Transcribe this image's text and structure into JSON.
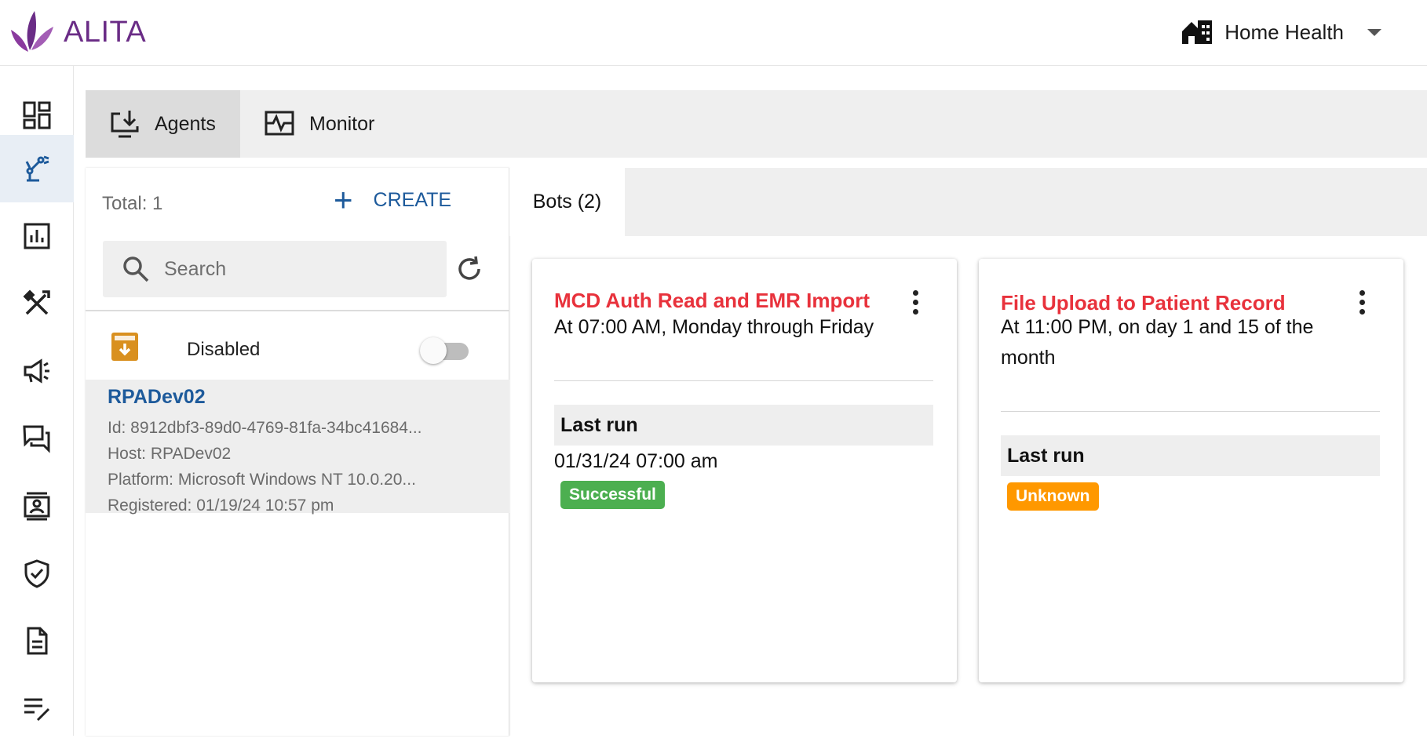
{
  "header": {
    "brand": "ALITA",
    "org_selector": "Home Health",
    "brand_color": "#6a2c86"
  },
  "sidebar": {
    "items": [
      {
        "icon": "dashboard-icon"
      },
      {
        "icon": "robot-arm-icon",
        "active": true
      },
      {
        "icon": "bar-chart-icon"
      },
      {
        "icon": "tools-icon"
      },
      {
        "icon": "megaphone-icon"
      },
      {
        "icon": "chat-icon"
      },
      {
        "icon": "contact-card-icon"
      },
      {
        "icon": "shield-check-icon"
      },
      {
        "icon": "document-icon"
      },
      {
        "icon": "edit-list-icon"
      }
    ]
  },
  "tabs": [
    {
      "label": "Agents",
      "icon": "download-monitor-icon",
      "active": true
    },
    {
      "label": "Monitor",
      "icon": "monitor-pulse-icon",
      "active": false
    }
  ],
  "agents_panel": {
    "total": "Total: 1",
    "create_label": "CREATE",
    "search_placeholder": "Search",
    "disabled_label": "Disabled",
    "agent": {
      "name": "RPADev02",
      "id": "Id: 8912dbf3-89d0-4769-81fa-34bc41684...",
      "host": "Host: RPADev02",
      "platform": "Platform: Microsoft Windows NT 10.0.20...",
      "registered": "Registered: 01/19/24 10:57 pm"
    }
  },
  "bots_panel": {
    "tab_label": "Bots (2)",
    "bots": [
      {
        "title": "MCD Auth Read and EMR Import",
        "schedule": "At 07:00 AM, Monday through Friday",
        "last_run_label": "Last run",
        "last_run_date": "01/31/24 07:00 am",
        "status": "Successful",
        "status_color": "#4caf50"
      },
      {
        "title": "File Upload to Patient Record",
        "schedule": "At 11:00 PM, on day 1 and 15 of the month",
        "last_run_label": "Last run",
        "status": "Unknown",
        "status_color": "#ff9800"
      }
    ]
  },
  "colors": {
    "accent": "#1d5a9b",
    "bot_title": "#e8323c",
    "archive_icon": "#d9901f"
  }
}
